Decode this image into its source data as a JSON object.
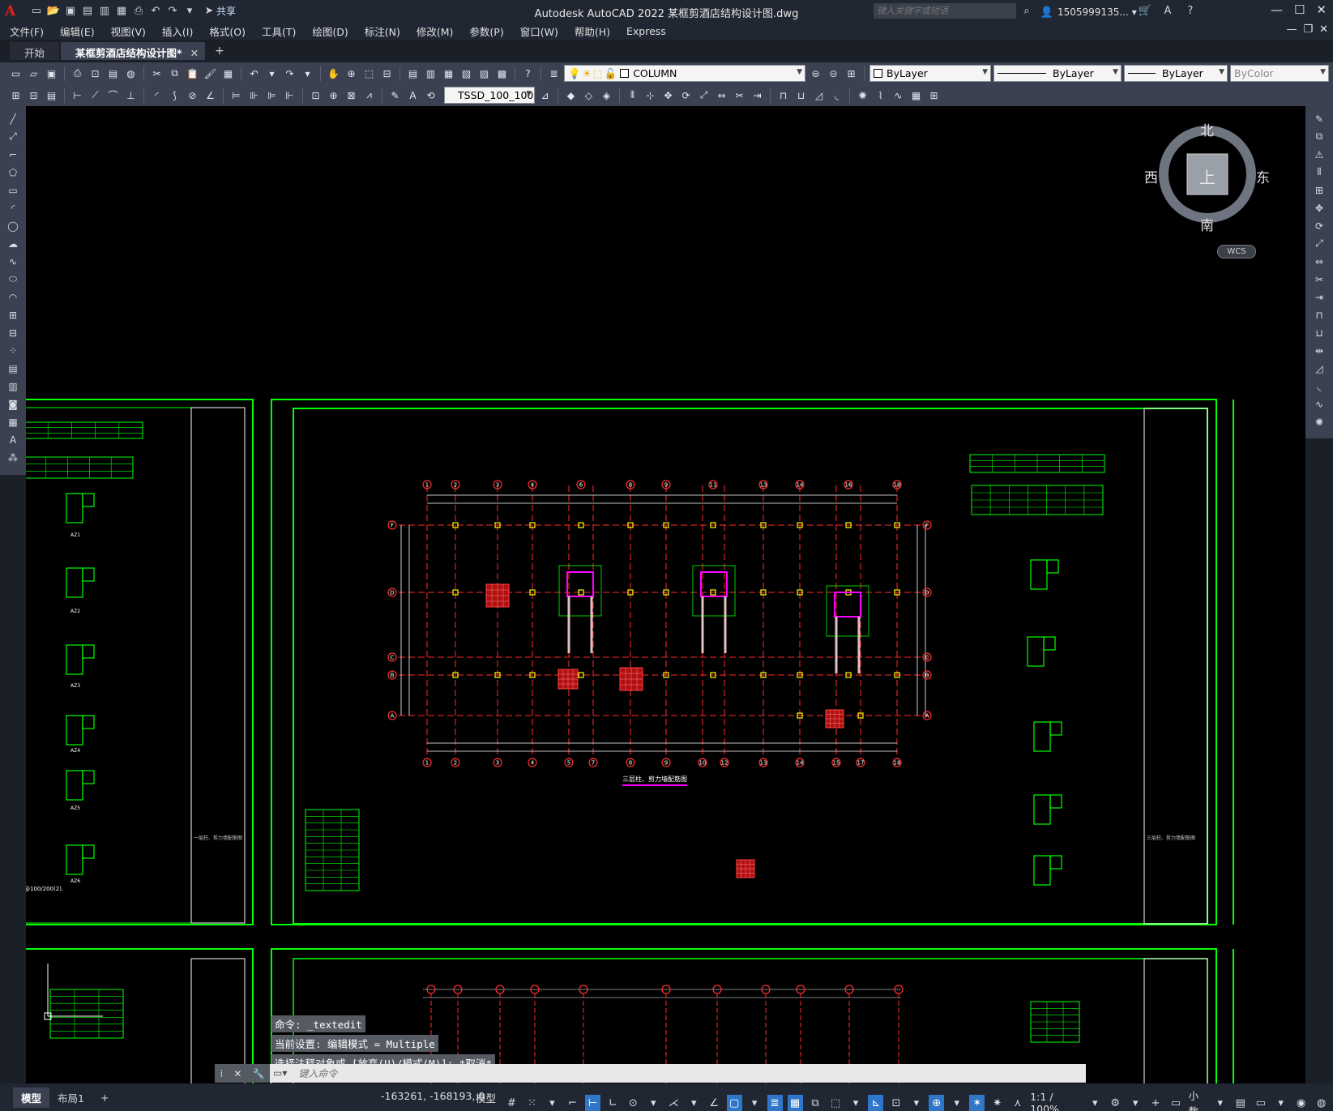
{
  "app": {
    "logo_letter": "A",
    "title": "Autodesk AutoCAD 2022    某框剪酒店结构设计图.dwg",
    "share_label": "共享",
    "search_placeholder": "键入关键字或短语",
    "user": "1505999135...",
    "colors": {
      "canvas": "#000000",
      "chrome": "#202632",
      "panel": "#3b4150",
      "accent": "#2f76c8"
    }
  },
  "menu": [
    "文件(F)",
    "编辑(E)",
    "视图(V)",
    "插入(I)",
    "格式(O)",
    "工具(T)",
    "绘图(D)",
    "标注(N)",
    "修改(M)",
    "参数(P)",
    "窗口(W)",
    "帮助(H)",
    "Express"
  ],
  "tabs": [
    {
      "label": "开始",
      "active": false
    },
    {
      "label": "某框剪酒店结构设计图*",
      "active": true
    }
  ],
  "toolbar": {
    "layer": "COLUMN",
    "color": "ByLayer",
    "linetype": "ByLayer",
    "lineweight": "ByLayer",
    "plotstyle": "ByColor",
    "textstyle": "TSSD_100_100"
  },
  "viewcube": {
    "north": "北",
    "south": "南",
    "east": "东",
    "west": "西",
    "top": "上",
    "wcs": "WCS"
  },
  "drawing": {
    "main_title": "三层柱、剪力墙配筋图",
    "row_labels": [
      "F",
      "D",
      "C",
      "B",
      "A"
    ],
    "top_axis": [
      "1",
      "2",
      "3",
      "4",
      "6",
      "8",
      "9",
      "11",
      "13",
      "14",
      "16",
      "18"
    ],
    "bottom_axis": [
      "1",
      "2",
      "3",
      "4",
      "5",
      "7",
      "8",
      "9",
      "10",
      "12",
      "13",
      "14",
      "15",
      "17",
      "18"
    ],
    "left_note": "@100/200(2).",
    "sheet_label_left": "一层柱、剪力墙配筋图",
    "sheet_label_right": "三层柱、剪力墙配筋图",
    "detail_labels": [
      "AZ1",
      "AZ2",
      "AZ3",
      "AZ4",
      "AZ5",
      "AZ6"
    ]
  },
  "command": {
    "history": [
      "命令: _textedit",
      "当前设置: 编辑模式 = Multiple",
      "选择注释对象或 [放弃(U)/模式(M)]: *取消*"
    ],
    "placeholder": "键入命令"
  },
  "status": {
    "layout_tabs": [
      "模型",
      "布局1"
    ],
    "coords": "-163261, -168193, 0",
    "model": "模型",
    "scale": "1:1 / 100%",
    "units": "小数"
  }
}
